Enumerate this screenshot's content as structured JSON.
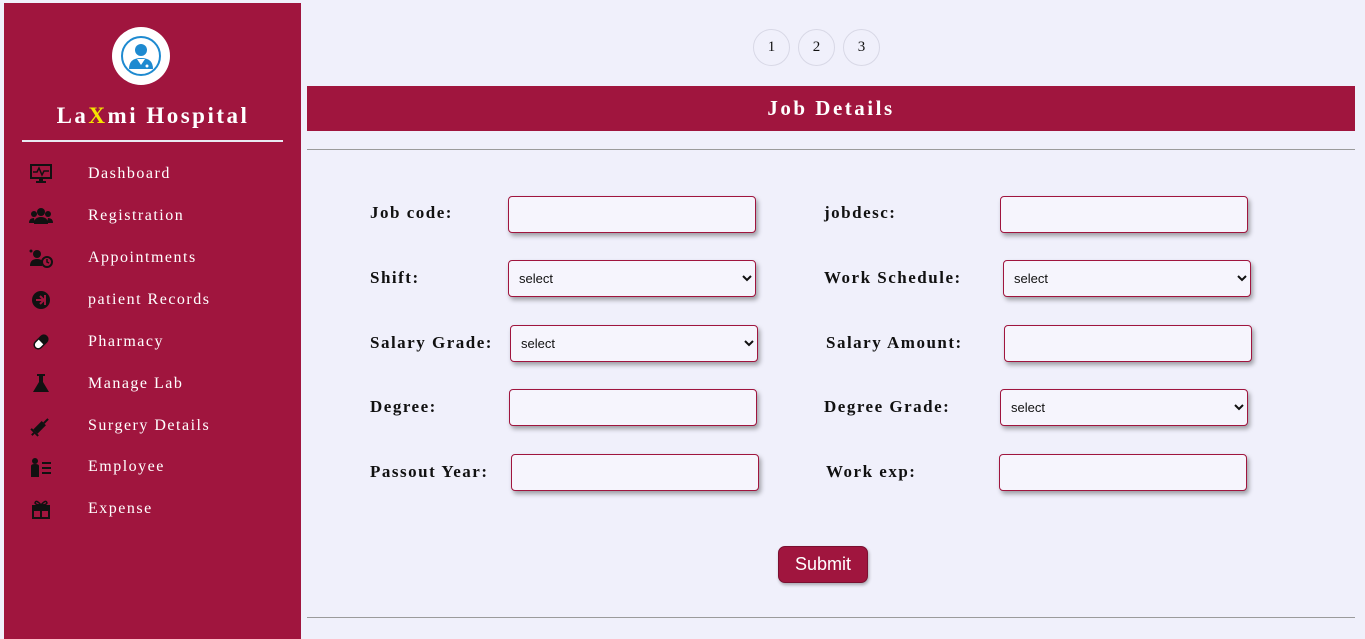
{
  "brand": {
    "prefix": "La",
    "highlight": "X",
    "suffix": "mi Hospital"
  },
  "sidebar": {
    "items": [
      {
        "label": "Dashboard",
        "icon": "monitor-icon"
      },
      {
        "label": "Registration",
        "icon": "users-icon"
      },
      {
        "label": "Appointments",
        "icon": "user-clock-icon"
      },
      {
        "label": "patient Records",
        "icon": "sign-in-icon"
      },
      {
        "label": "Pharmacy",
        "icon": "pill-icon"
      },
      {
        "label": "Manage Lab",
        "icon": "flask-icon"
      },
      {
        "label": "Surgery Details",
        "icon": "syringe-icon"
      },
      {
        "label": "Employee",
        "icon": "user-list-icon"
      },
      {
        "label": "Expense",
        "icon": "gift-icon"
      }
    ]
  },
  "pager": {
    "pages": [
      "1",
      "2",
      "3"
    ]
  },
  "banner": {
    "title": "Job Details"
  },
  "form": {
    "job_code": {
      "label": "Job code:",
      "value": ""
    },
    "jobdesc": {
      "label": "jobdesc:",
      "value": ""
    },
    "shift": {
      "label": "Shift:",
      "selected": "select"
    },
    "work_schedule": {
      "label": "Work Schedule:",
      "selected": "select"
    },
    "salary_grade": {
      "label": "Salary Grade:",
      "selected": "select"
    },
    "salary_amount": {
      "label": "Salary Amount:",
      "value": ""
    },
    "degree": {
      "label": "Degree:",
      "value": ""
    },
    "degree_grade": {
      "label": "Degree Grade:",
      "selected": "select"
    },
    "passout_year": {
      "label": "Passout Year:",
      "value": ""
    },
    "work_exp": {
      "label": "Work exp:",
      "value": ""
    },
    "submit_label": "Submit"
  },
  "colors": {
    "primary": "#a0153e",
    "background": "#f0f0fb",
    "brand_highlight": "#f5e400"
  }
}
